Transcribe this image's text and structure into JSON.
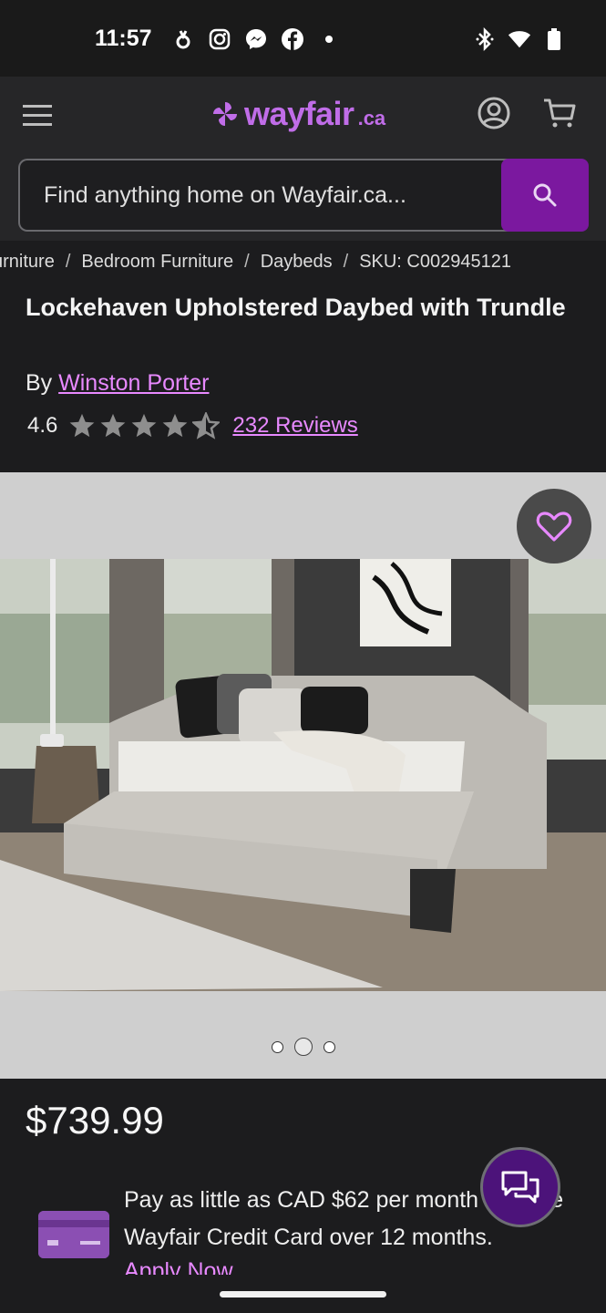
{
  "status_bar": {
    "time": "11:57",
    "left_icons": [
      "notification-icon",
      "instagram-icon",
      "messenger-icon",
      "facebook-icon",
      "dot-icon"
    ],
    "right_icons": [
      "bluetooth-icon",
      "wifi-icon",
      "battery-icon"
    ]
  },
  "header": {
    "logo_text": "wayfair",
    "logo_suffix": ".ca",
    "search_placeholder": "Find anything home on Wayfair.ca...",
    "brand_color": "#7b189f",
    "logo_color": "#c06de8"
  },
  "breadcrumb": [
    "urniture",
    "Bedroom Furniture",
    "Daybeds",
    "SKU: C002945121"
  ],
  "breadcrumb_separator": "/",
  "product": {
    "title": "Lockehaven Upholstered Daybed with Trundle",
    "by_label": "By",
    "brand": "Winston Porter",
    "rating": "4.6",
    "rating_value": 4.6,
    "rating_max": 5,
    "reviews_label": "232 Reviews",
    "price": "$739.99",
    "gallery_dots": 3,
    "gallery_active_index": 1
  },
  "financing": {
    "text": "Pay as little as CAD $62 per month with the Wayfair Credit Card over 12 months.",
    "apply_label": "Apply Now"
  },
  "accent_link_color": "#e889ff"
}
